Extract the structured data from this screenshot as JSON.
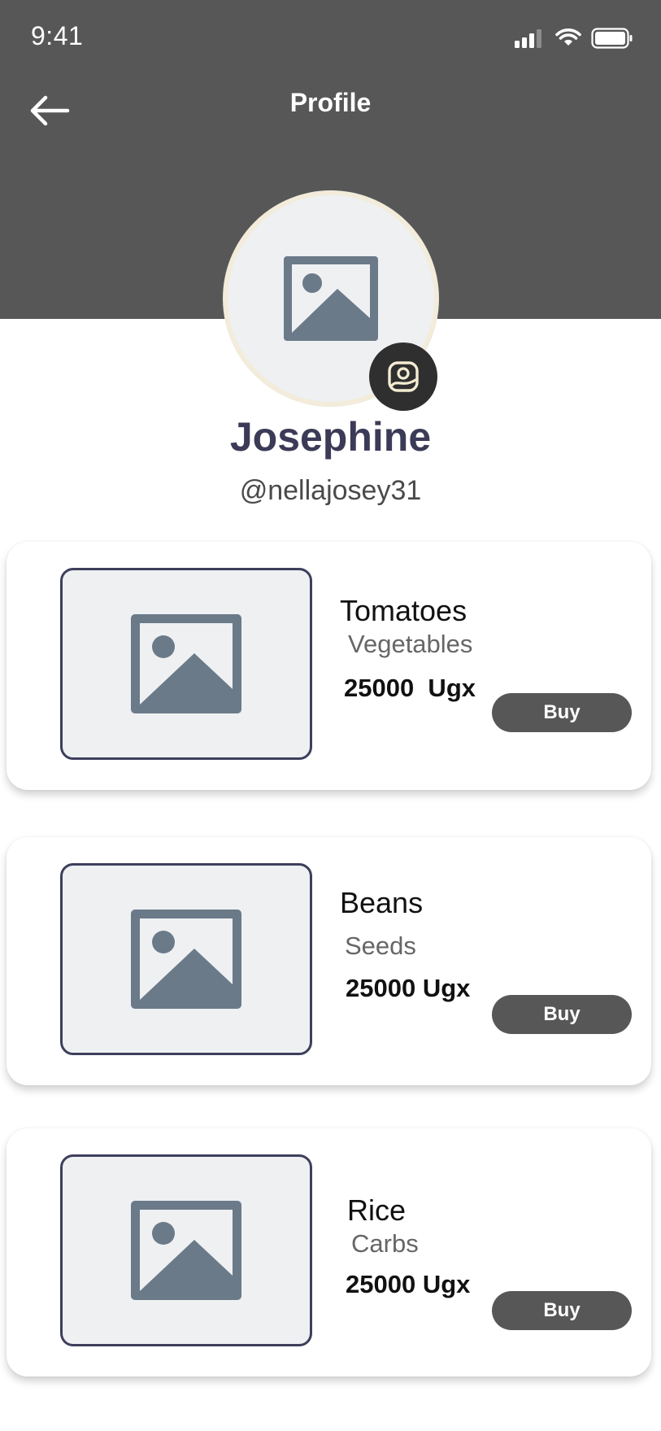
{
  "status_bar": {
    "time": "9:41"
  },
  "header": {
    "title": "Profile"
  },
  "profile": {
    "name": "Josephine",
    "handle": "@nellajosey31"
  },
  "products": [
    {
      "name": "Tomatoes",
      "category": "Vegetables",
      "price": "25000  Ugx",
      "action": "Buy"
    },
    {
      "name": "Beans",
      "category": "Seeds",
      "price": "25000 Ugx",
      "action": "Buy"
    },
    {
      "name": "Rice",
      "category": "Carbs",
      "price": "25000 Ugx",
      "action": "Buy"
    }
  ],
  "colors": {
    "header_bg": "#575757",
    "button_bg": "#575757",
    "name_text": "#3b3b58",
    "placeholder_bg": "#eef0f2",
    "placeholder_icon": "#6b7a89",
    "image_border": "#3e3f5c"
  },
  "icons": {
    "back": "arrow-left-icon",
    "avatar": "image-placeholder-icon",
    "avatar_edit": "image-edit-icon",
    "signal": "cellular-signal-icon",
    "wifi": "wifi-icon",
    "battery": "battery-icon"
  }
}
